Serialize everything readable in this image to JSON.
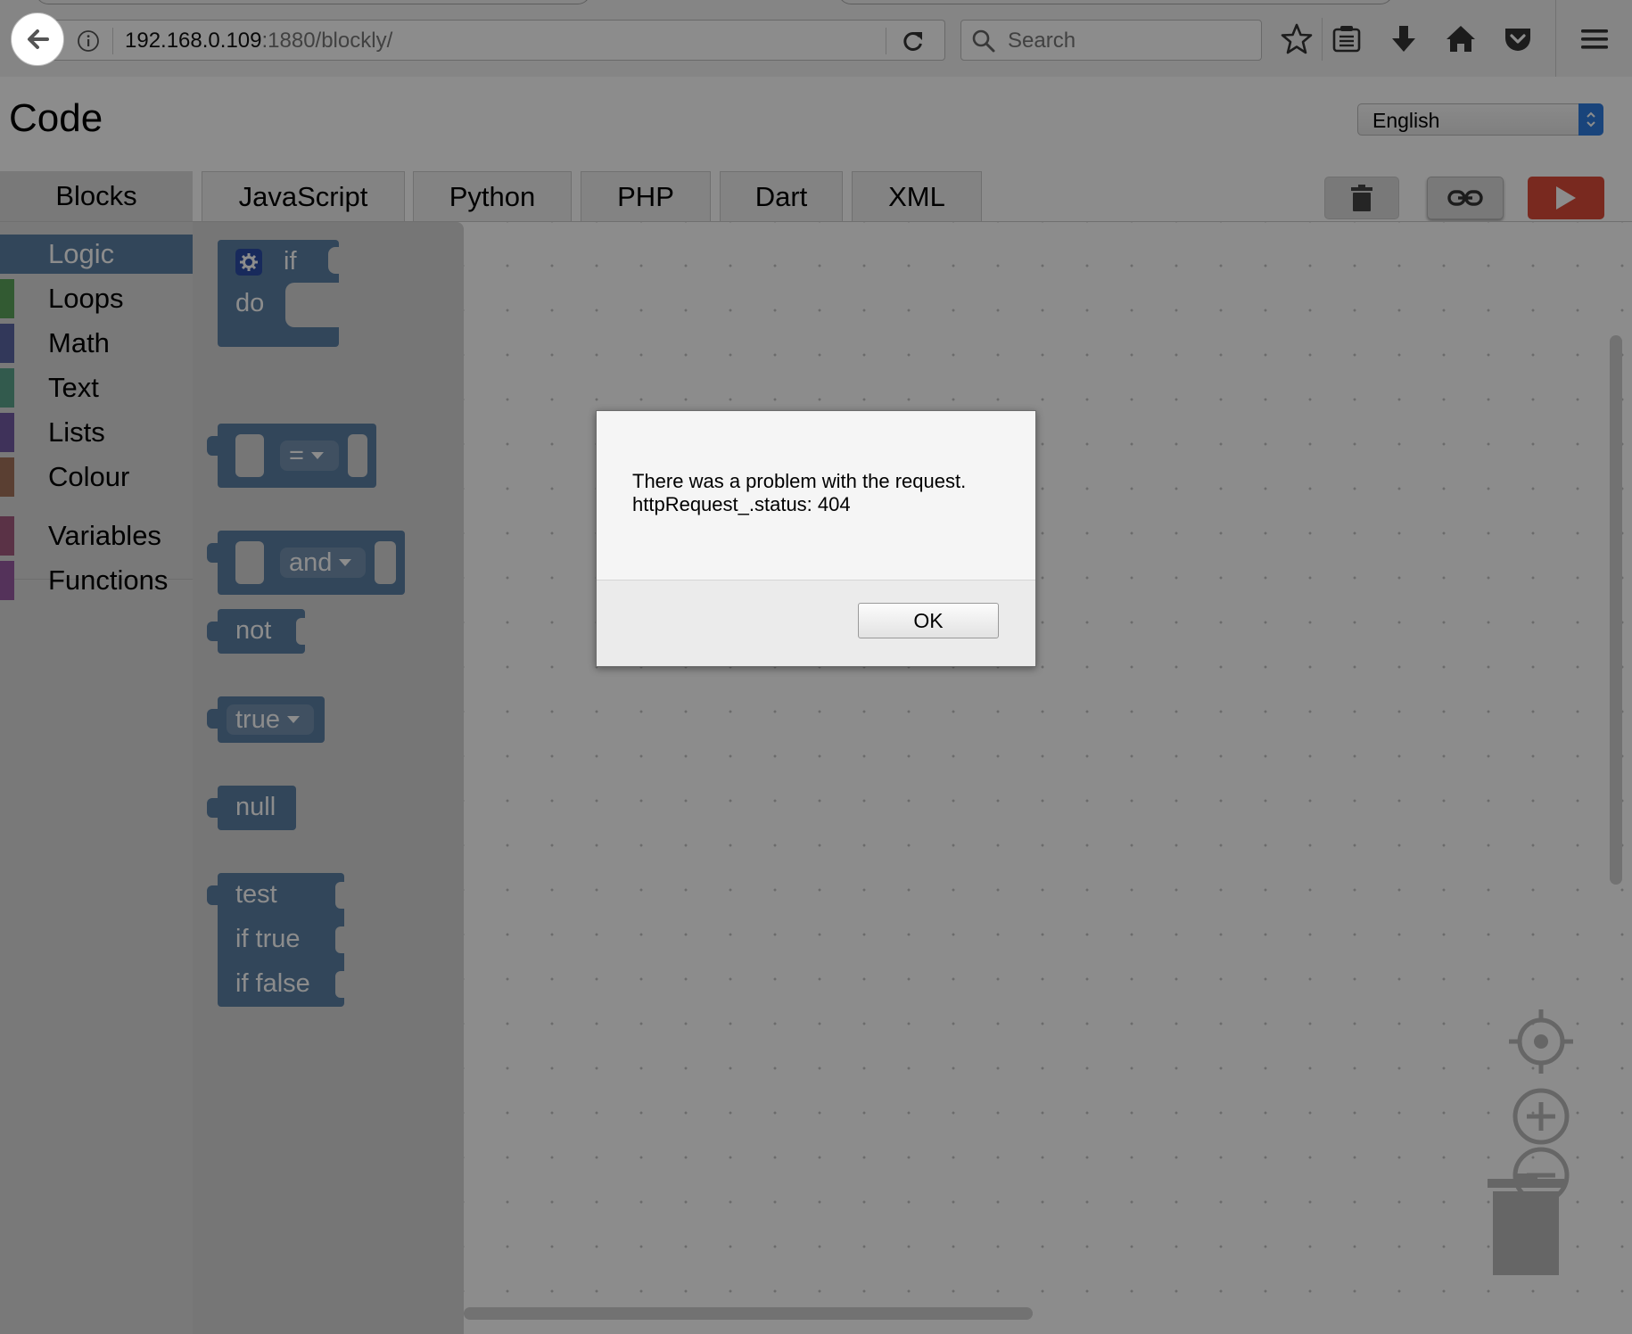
{
  "browser": {
    "url_host": "192.168.0.109",
    "url_rest": ":1880/blockly/",
    "search_placeholder": "Search"
  },
  "page": {
    "title": "Code",
    "language_value": "English",
    "tabs": [
      "Blocks",
      "JavaScript",
      "Python",
      "PHP",
      "Dart",
      "XML"
    ]
  },
  "toolbox": {
    "categories": [
      {
        "label": "Logic",
        "color": "#5b80a5"
      },
      {
        "label": "Loops",
        "color": "#5ba55b"
      },
      {
        "label": "Math",
        "color": "#5b67a5"
      },
      {
        "label": "Text",
        "color": "#5ba58c"
      },
      {
        "label": "Lists",
        "color": "#745ba5"
      },
      {
        "label": "Colour",
        "color": "#a5745b"
      },
      {
        "label": "Variables",
        "color": "#a55b80"
      },
      {
        "label": "Functions",
        "color": "#995ba5"
      }
    ]
  },
  "flyout": {
    "if_label": "if",
    "do_label": "do",
    "compare_op": "=",
    "and_op": "and",
    "not_label": "not",
    "bool_value": "true",
    "null_label": "null",
    "ternary_test": "test",
    "ternary_true": "if true",
    "ternary_false": "if false"
  },
  "dialog": {
    "line1": "There was a problem with the request.",
    "line2": "httpRequest_.status: 404",
    "ok_label": "OK"
  },
  "colors": {
    "logic_block": "#5b80a5",
    "run_button": "#dd4b39",
    "select_arrow": "#2f7de1"
  }
}
